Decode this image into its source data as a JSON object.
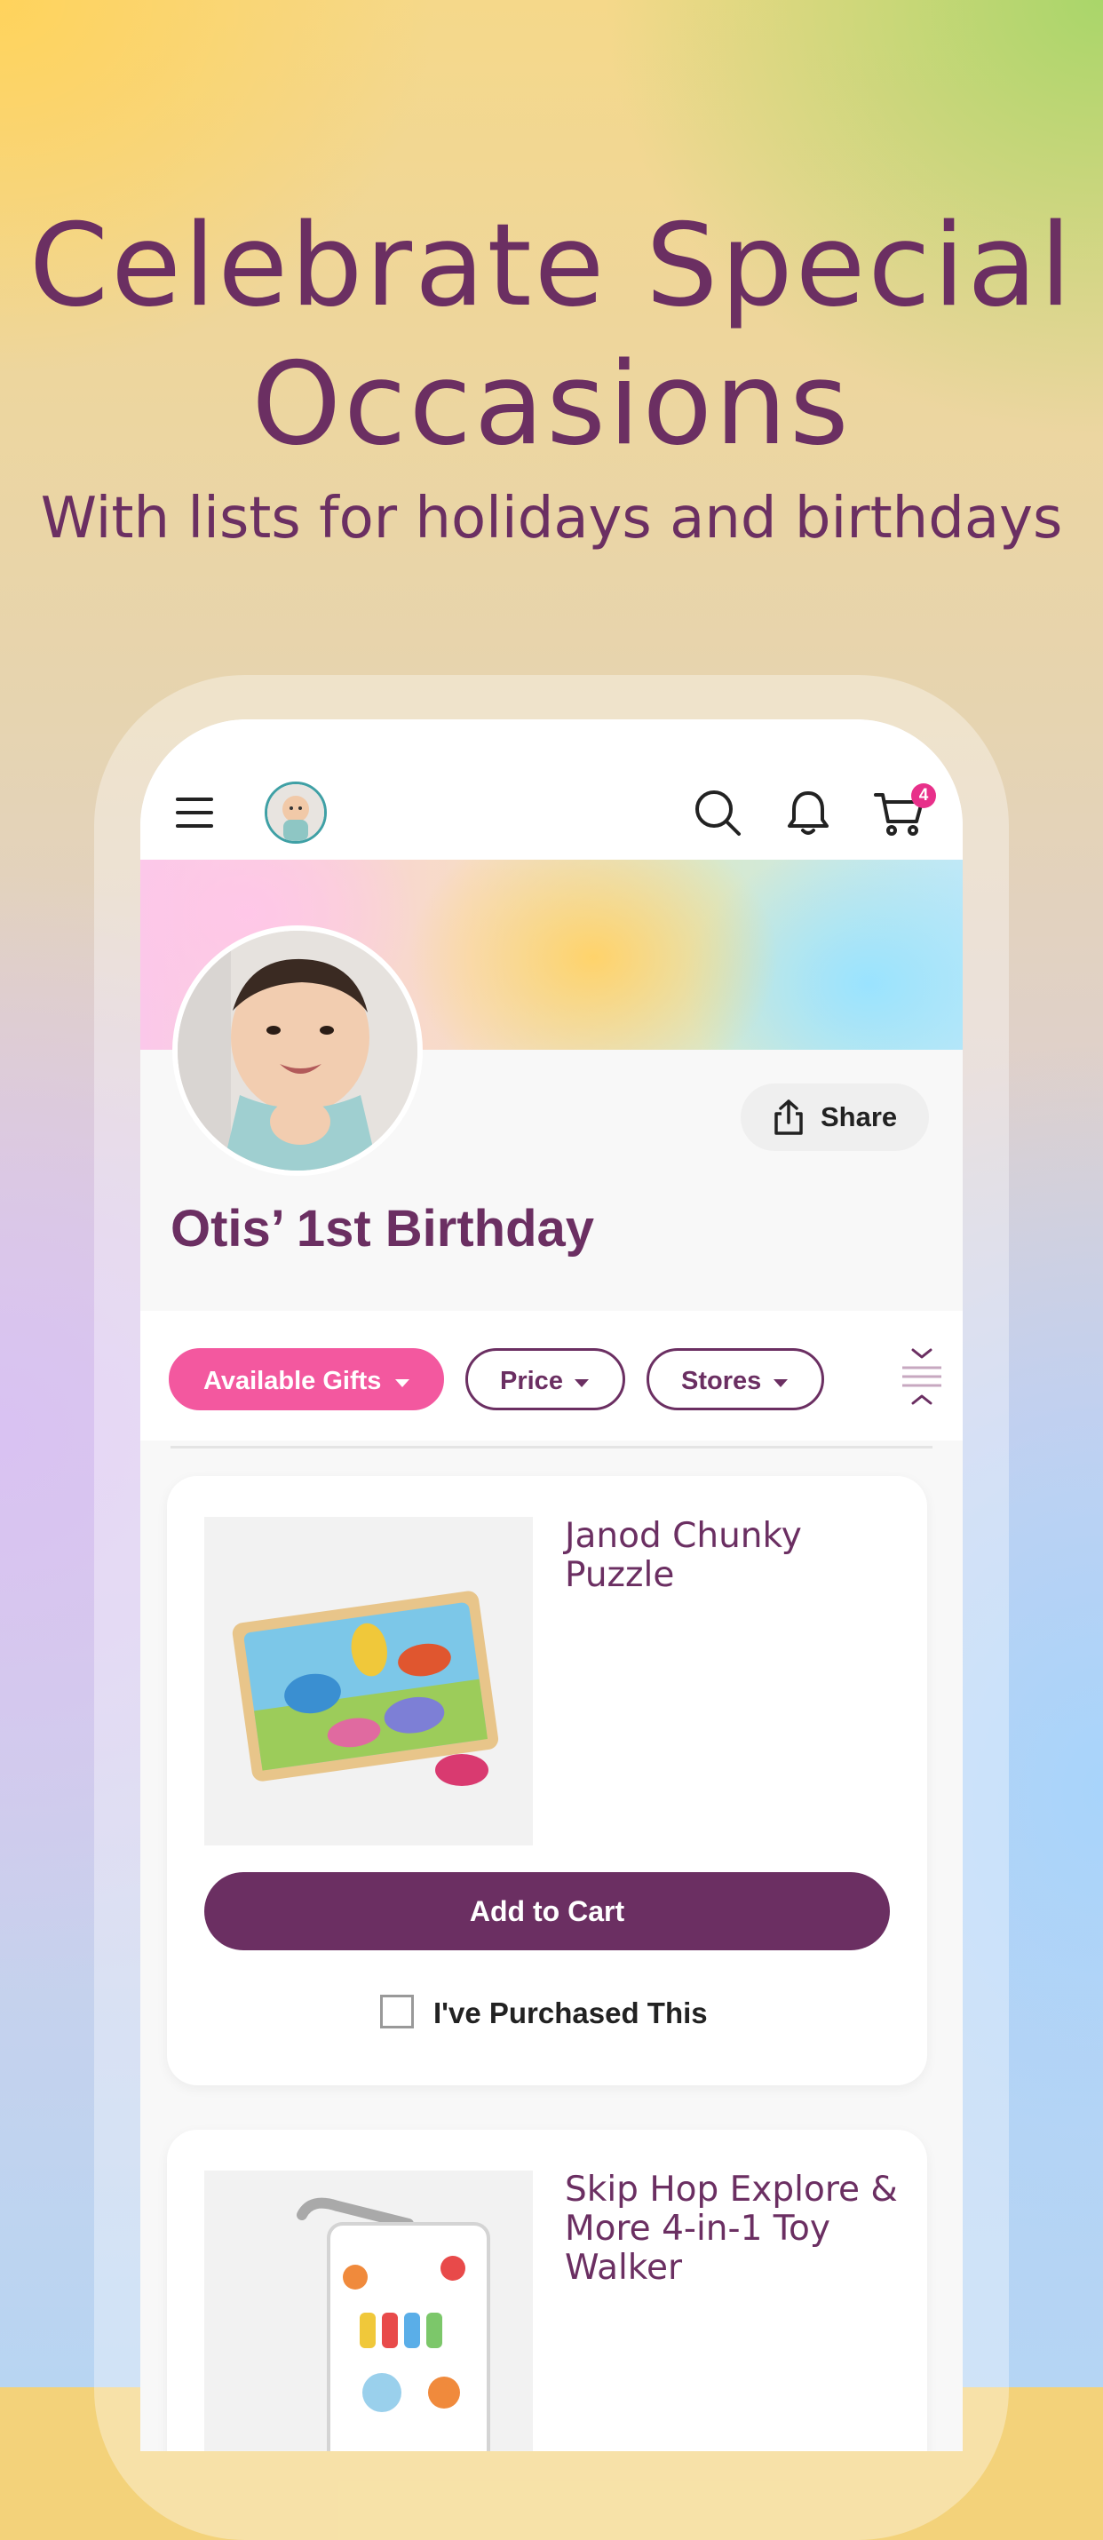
{
  "hero": {
    "headline_line1": "Celebrate Special",
    "headline_line2": "Occasions",
    "subheadline": "With lists for holidays and birthdays"
  },
  "topbar": {
    "menu_icon": "hamburger-menu-icon",
    "avatar": "user-avatar",
    "search_icon": "search-icon",
    "notifications_icon": "bell-icon",
    "cart_icon": "cart-icon",
    "cart_count": "4"
  },
  "profile": {
    "share_label": "Share",
    "list_title": "Otis’ 1st Birthday"
  },
  "filters": {
    "items": [
      {
        "label": "Available Gifts",
        "active": true
      },
      {
        "label": "Price",
        "active": false
      },
      {
        "label": "Stores",
        "active": false
      }
    ],
    "sort_icon": "collapse-expand-icon"
  },
  "gifts": [
    {
      "title": "Janod Chunky Puzzle",
      "add_to_cart_label": "Add to Cart",
      "purchased_label": "I've Purchased This"
    },
    {
      "title": "Skip Hop Explore & More 4-in-1 Toy Walker"
    }
  ],
  "colors": {
    "brand_purple": "#6b2f62",
    "accent_pink": "#f3589f",
    "badge_pink": "#e8308a"
  }
}
